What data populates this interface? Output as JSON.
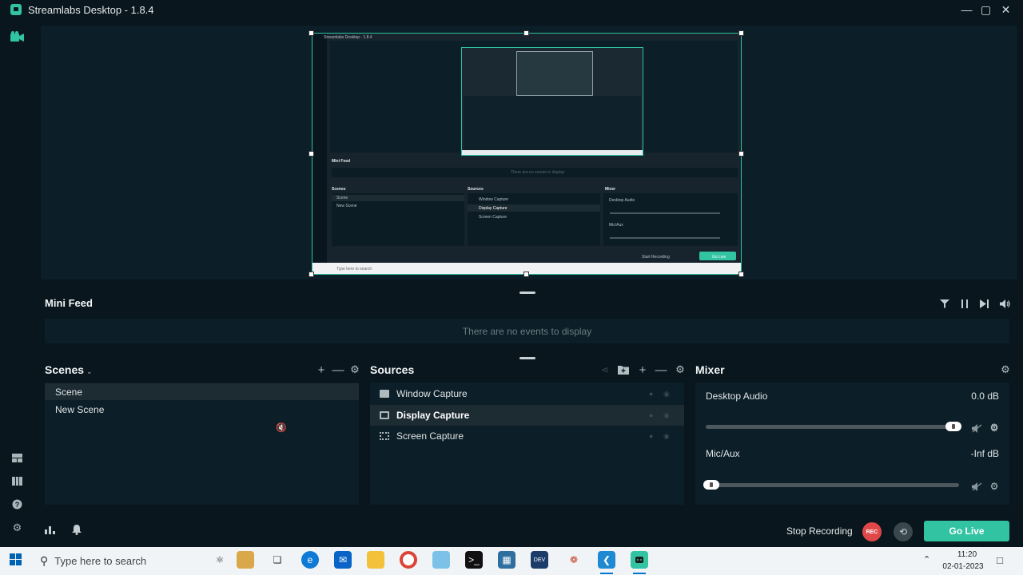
{
  "window": {
    "title": "Streamlabs Desktop - 1.8.4"
  },
  "preview": {
    "nested_title": "Streamlabs Desktop - 1.8.4",
    "nested_minifeed": "Mini Feed",
    "nested_no_events": "There are no events to display",
    "nested_scenes": "Scenes",
    "nested_sources": "Sources",
    "nested_mixer": "Mixer",
    "nested_scene_items": [
      "Scene",
      "New Scene"
    ],
    "nested_source_items": [
      "Window Capture",
      "Display Capture",
      "Screen Capture"
    ],
    "nested_desktop_audio": "Desktop Audio",
    "nested_micaux": "Mic/Aux",
    "nested_stop_recording": "Start Recording",
    "nested_golive": "Go Live",
    "nested_search": "Type here to search"
  },
  "minifeed": {
    "title": "Mini Feed",
    "empty_text": "There are no events to display"
  },
  "scenes": {
    "title": "Scenes",
    "items": [
      "Scene",
      "New Scene"
    ],
    "selected": "Scene"
  },
  "sources": {
    "title": "Sources",
    "items": [
      {
        "label": "Window Capture",
        "icon": "window-icon"
      },
      {
        "label": "Display Capture",
        "icon": "monitor-icon"
      },
      {
        "label": "Screen Capture",
        "icon": "screen-region-icon"
      }
    ],
    "selected": "Display Capture"
  },
  "mixer": {
    "title": "Mixer",
    "channels": [
      {
        "name": "Desktop Audio",
        "db": "0.0 dB",
        "level": 1.0
      },
      {
        "name": "Mic/Aux",
        "db": "-Inf dB",
        "level": 0.0
      }
    ]
  },
  "footer": {
    "stop_recording_label": "Stop Recording",
    "rec_label": "REC",
    "go_live_label": "Go Live"
  },
  "taskbar": {
    "search_placeholder": "Type here to search",
    "time": "11:20",
    "date": "02-01-2023"
  },
  "colors": {
    "accent": "#31c3a2",
    "background": "#09161d",
    "panel": "#0c1e27",
    "rec": "#e04848"
  }
}
